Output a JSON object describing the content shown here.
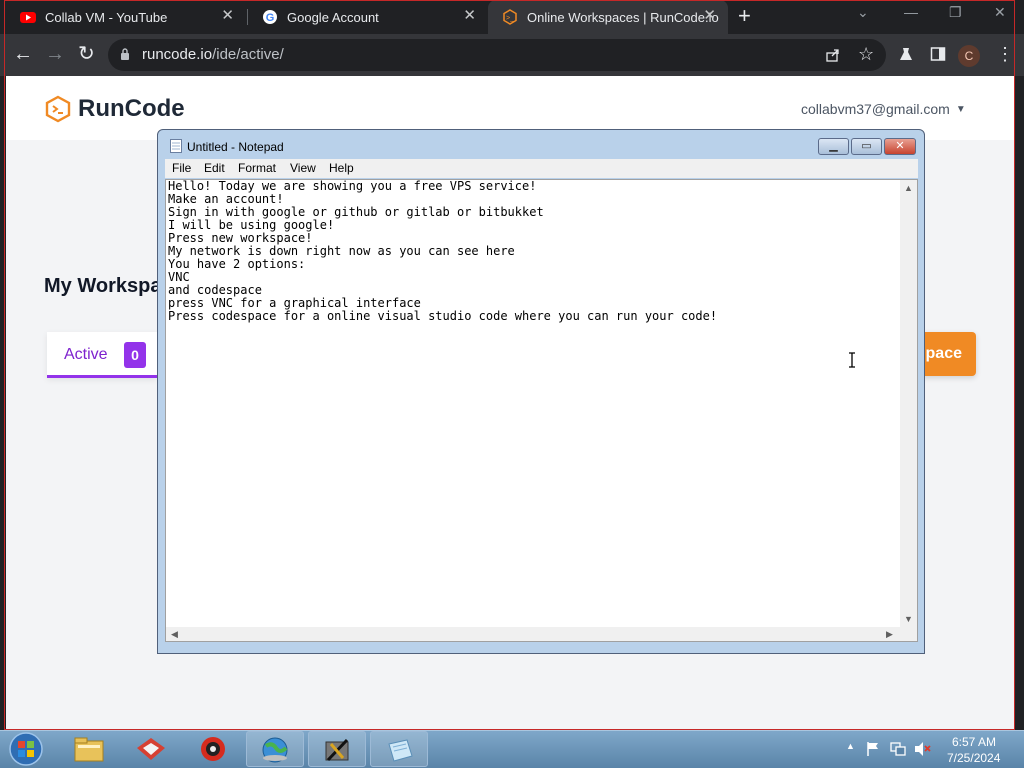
{
  "browser": {
    "tabs": [
      {
        "title": "Collab VM - YouTube",
        "icon": "youtube-icon"
      },
      {
        "title": "Google Account",
        "icon": "google-icon"
      },
      {
        "title": "Online Workspaces | RunCode.io",
        "icon": "runcode-icon",
        "active": true
      }
    ],
    "url_host": "runcode.io",
    "url_path": "/ide/active/",
    "profile_initial": "C",
    "colors": {
      "frame": "#202124",
      "toolbar": "#35363a",
      "accent": "#f08a24"
    }
  },
  "site": {
    "brand": "RunCode",
    "account": "collabvm37@gmail.com",
    "workspaces_title": "My Workspa",
    "active_tab_label": "Active",
    "active_count": "0",
    "new_workspace_label": "pace",
    "colors": {
      "purple": "#9333ea",
      "orange": "#f08a24"
    }
  },
  "notepad": {
    "title": "Untitled - Notepad",
    "menu": [
      "File",
      "Edit",
      "Format",
      "View",
      "Help"
    ],
    "text": "Hello! Today we are showing you a free VPS service!\nMake an account!\nSign in with google or github or gitlab or bitbukket\nI will be using google!\nPress new workspace!\nMy network is down right now as you can see here\nYou have 2 options:\nVNC\nand codespace\npress VNC for a graphical interface\nPress codespace for a online visual studio code where you can run your code!"
  },
  "taskbar": {
    "time": "6:57 AM",
    "date": "7/25/2024",
    "apps": [
      "explorer-icon",
      "app-red-icon",
      "app-globe-icon",
      "network-globe-icon",
      "app-tools-icon",
      "notepad-icon"
    ]
  }
}
